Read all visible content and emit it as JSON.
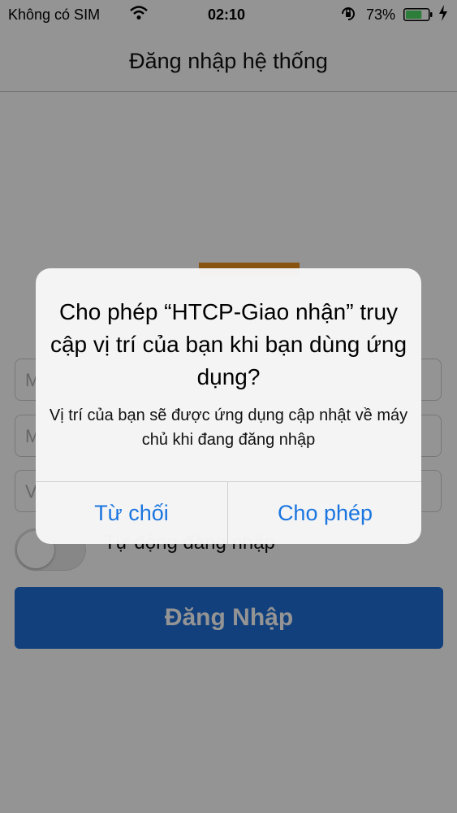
{
  "status_bar": {
    "carrier": "Không có SIM",
    "time": "02:10",
    "battery_percent": "73%",
    "battery_level": 0.73,
    "icons": [
      "wifi-icon",
      "rotation-lock-icon",
      "battery-icon",
      "charging-bolt-icon"
    ]
  },
  "nav": {
    "title": "Đăng nhập hệ thống"
  },
  "form": {
    "fields": [
      {
        "placeholder": "M"
      },
      {
        "placeholder": "M"
      },
      {
        "placeholder": "V"
      }
    ],
    "auto_login_label": "Tự động đăng nhập",
    "auto_login_on": false,
    "login_button": "Đăng Nhập"
  },
  "alert": {
    "title": "Cho phép “HTCP-Giao nhận” truy cập vị trí của bạn khi bạn dùng ứng dụng?",
    "message": "Vị trí của bạn sẽ được ứng dụng cập nhật về máy chủ khi đang đăng nhập",
    "deny": "Từ chối",
    "allow": "Cho phép"
  },
  "colors": {
    "primary": "#1f6fd6",
    "accent_orange": "#e9901b",
    "ios_blue": "#1a75e0"
  }
}
